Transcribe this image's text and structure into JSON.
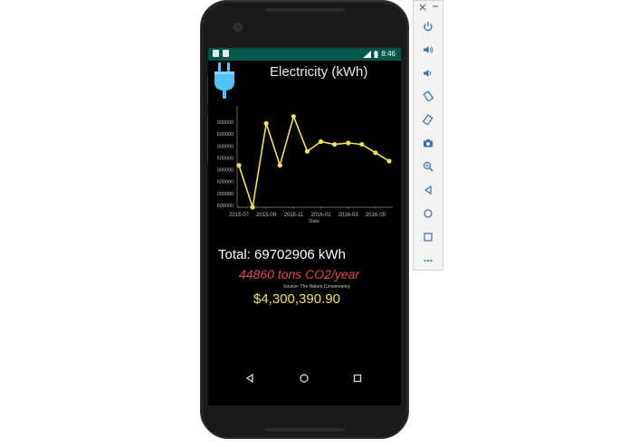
{
  "status_bar": {
    "time": "8:46"
  },
  "app": {
    "title": "Electricity (kWh)",
    "total": "Total: 69702906 kWh",
    "co2": "44860 tons CO2/year",
    "source": "Source: The Nature Conservancy",
    "cost": "$4,300,390.90"
  },
  "chart_data": {
    "type": "line",
    "xlabel": "Date",
    "x_ticks": [
      "2015-07",
      "2015-09",
      "2015-11",
      "2016-01",
      "2016-03",
      "2016-05"
    ],
    "y_ticks": [
      "000000",
      "500000",
      "000000",
      "500000",
      "000000",
      "500000",
      "000000",
      "500000"
    ],
    "x": [
      "2015-07",
      "2015-08",
      "2015-09",
      "2015-10",
      "2015-11",
      "2015-12",
      "2016-01",
      "2016-02",
      "2016-03",
      "2016-04",
      "2016-05",
      "2016-06"
    ],
    "values": [
      4.0,
      1.0,
      7.0,
      4.0,
      7.5,
      5.0,
      5.7,
      5.5,
      5.6,
      5.5,
      4.9,
      4.3
    ],
    "ylim": [
      1.0,
      8.0
    ],
    "line_color": "#f2e24a",
    "grid": false
  },
  "colors": {
    "status_bar": "#00574b",
    "screen_bg": "#000000",
    "co2_text": "#e0484d",
    "cost_text": "#f0e25a",
    "plug_icon": "#4fc3f7"
  },
  "nav": {
    "icons": [
      "back-icon",
      "home-icon",
      "recents-icon"
    ]
  },
  "emulator_toolbar": {
    "icons": [
      "power-icon",
      "volume-up-icon",
      "volume-down-icon",
      "rotate-left-icon",
      "rotate-right-icon",
      "camera-icon",
      "zoom-icon",
      "back-icon",
      "home-icon",
      "overview-icon",
      "more-icon"
    ]
  }
}
